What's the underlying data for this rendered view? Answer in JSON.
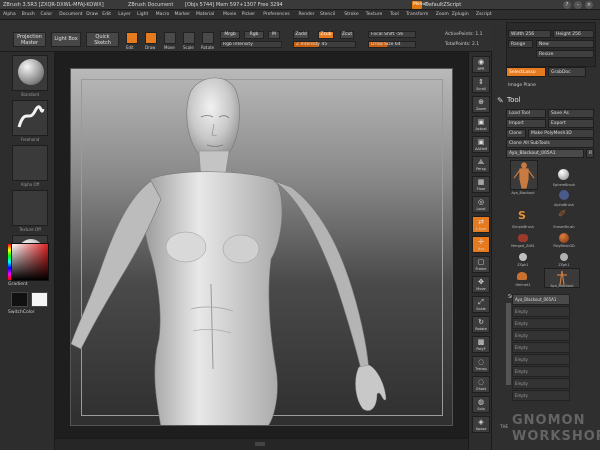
{
  "titlebar": {
    "title": "ZBrush 3.5R3 [ZXQR-DXWL-MFAJ-KOWX]",
    "document": "ZBrush Document",
    "stats": "[Objs 5744] Mem 597+1307 Free 3294",
    "menus_label": "Menus",
    "default_label": "DefaultZScript"
  },
  "menubar": [
    "Alpha",
    "Brush",
    "Color",
    "Document",
    "Draw",
    "Edit",
    "Layer",
    "Light",
    "Macro",
    "Marker",
    "Material",
    "Movie",
    "Picker",
    "Preferences",
    "Render",
    "Stencil",
    "Stroke",
    "Texture",
    "Tool",
    "Transform",
    "Zoom",
    "Zplugin",
    "Zscript"
  ],
  "shelf": {
    "projection_master": "Projection Master",
    "lightbox": "Light Box",
    "quick_sketch": "Quick Sketch",
    "edit": "Edit",
    "draw": "Draw",
    "move": "Move",
    "scale": "Scale",
    "rotate": "Rotate",
    "mrgb": "Mrgb",
    "rgb": "Rgb",
    "m": "M",
    "rgb_intensity": "Rgb Intensity",
    "zadd": "Zadd",
    "zsub": "Zsub",
    "zcut": "Zcut",
    "z_intensity": "Z Intensity 45",
    "focal_shift": "Focal Shift -56",
    "draw_size": "Draw Size 64",
    "active_points": "ActivePoints: 1.1",
    "total_points": "TotalPoints: 2.1"
  },
  "leftshelf": {
    "brush": "Standard",
    "stroke": "Freehand",
    "alpha": "Alpha Off",
    "texture": "Texture Off",
    "material": "SkinShade4",
    "gradient": "Gradient",
    "switch_color": "SwitchColor"
  },
  "rightstrip": [
    "BPR",
    "Scroll",
    "Zoom",
    "Actual",
    "AAHalf",
    "Persp",
    "Floor",
    "Local",
    "L.Sym",
    "Xyz",
    "Frame",
    "Move",
    "Scale",
    "Rotate",
    "PolyF",
    "Transp",
    "Ghost",
    "Solo",
    "Xpose"
  ],
  "righttray": {
    "width": "Width 256",
    "height": "Height 256",
    "range": "Range",
    "new": "New",
    "resize": "Resize",
    "select_lasso": "SelectLasso",
    "grab_doc": "GrabDoc",
    "image_plane": "Image Plane",
    "tool_title": "Tool",
    "load_tool": "Load Tool",
    "save_as": "Save As",
    "import": "Import",
    "export": "Export",
    "clone": "Clone",
    "make_polymesh": "Make PolyMesh3D",
    "clone_all": "Clone All SubTools",
    "current_tool": "Aya_Blackout_005A1",
    "r_label": "R",
    "thumbs": [
      "Aya_Blackout",
      "SphereBrush",
      "AlphaBrush",
      "SimpleBrush",
      "EraserBrush",
      "Merged_ZcB1",
      "PolyMesh3D",
      "ZSph1",
      "ZSph1",
      "Helmet1",
      "Aya_Blackout"
    ],
    "subtool_title": "SubTool",
    "subtool_selected": "Aya_Blackout_005A1",
    "subtool_empty": [
      "Empty",
      "Empty",
      "Empty",
      "Empty",
      "Empty",
      "Empty",
      "Empty",
      "Empty"
    ]
  },
  "watermark": {
    "the": "THE",
    "line1": "GNOMON",
    "line2": "WORKSHOP"
  },
  "colors": {
    "accent": "#e57a1e",
    "panel": "#2f2f2f",
    "canvas_top": "#b9b9b9"
  }
}
